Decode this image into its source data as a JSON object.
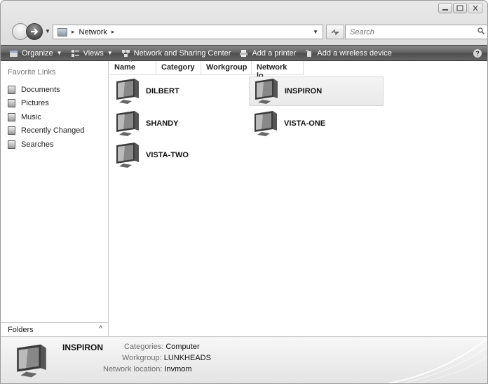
{
  "window": {
    "caption_buttons": [
      "minimize",
      "maximize",
      "close"
    ]
  },
  "address_bar": {
    "location": "Network",
    "separator": "▸",
    "trailing_separator": "▸"
  },
  "search": {
    "placeholder": "Search"
  },
  "toolbar": {
    "items": [
      {
        "label": "Organize",
        "icon": "organize-icon",
        "dropdown": true
      },
      {
        "label": "Views",
        "icon": "views-icon",
        "dropdown": true
      },
      {
        "label": "Network and Sharing Center",
        "icon": "network-center-icon",
        "dropdown": false
      },
      {
        "label": "Add a printer",
        "icon": "printer-icon",
        "dropdown": false
      },
      {
        "label": "Add a wireless device",
        "icon": "wireless-icon",
        "dropdown": false
      }
    ],
    "help_label": "?"
  },
  "sidebar": {
    "heading": "Favorite Links",
    "items": [
      {
        "label": "Documents",
        "icon": "documents-icon"
      },
      {
        "label": "Pictures",
        "icon": "pictures-icon"
      },
      {
        "label": "Music",
        "icon": "music-icon"
      },
      {
        "label": "Recently Changed",
        "icon": "recently-changed-icon"
      },
      {
        "label": "Searches",
        "icon": "searches-icon"
      }
    ],
    "folders_label": "Folders",
    "folders_chevron": "^"
  },
  "columns": [
    "Name",
    "Category",
    "Workgroup",
    "Network lo..."
  ],
  "computers": [
    {
      "name": "DILBERT",
      "selected": false
    },
    {
      "name": "INSPIRON",
      "selected": true
    },
    {
      "name": "SHANDY",
      "selected": false
    },
    {
      "name": "VISTA-ONE",
      "selected": false
    },
    {
      "name": "VISTA-TWO",
      "selected": false
    }
  ],
  "details": {
    "name": "INSPIRON",
    "categories_key": "Categories:",
    "categories_value": "Computer",
    "workgroup_key": "Workgroup:",
    "workgroup_value": "LUNKHEADS",
    "location_key": "Network location:",
    "location_value": "Invmom"
  },
  "colors": {
    "toolbar_dark": "#4d4d4d",
    "selection": "#e9e9e9"
  }
}
